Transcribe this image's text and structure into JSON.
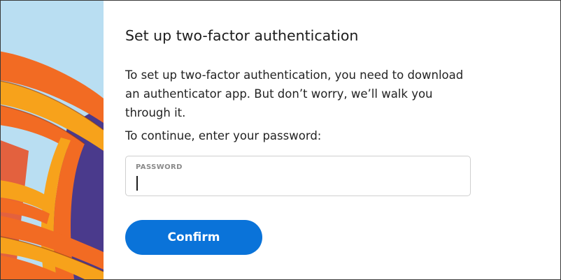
{
  "dialog": {
    "title": "Set up two-factor authentication",
    "intro": "To set up two-factor authentication, you need to download an authenticator app. But don’t worry, we’ll walk you through it.",
    "prompt": "To continue, enter your password:"
  },
  "password_field": {
    "label": "PASSWORD",
    "value": "",
    "placeholder": ""
  },
  "confirm_button": {
    "label": "Confirm"
  },
  "colors": {
    "accent": "#0a73d9",
    "art_sky": "#b9def2",
    "art_orange": "#f26b23",
    "art_yellow": "#f7a21b",
    "art_purple": "#4a3a8c"
  }
}
